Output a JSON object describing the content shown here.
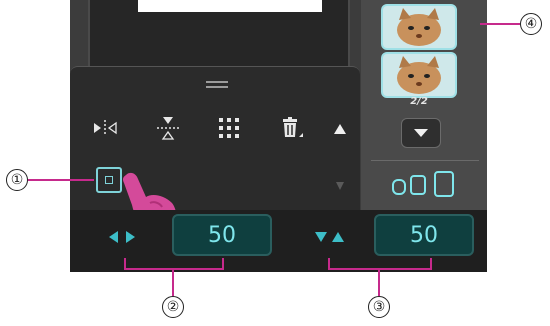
{
  "editor": {
    "page_count": "2/2",
    "horizontal_value": "50",
    "vertical_value": "50"
  },
  "tools": {
    "mirror_horizontal": "mirror-horizontal-icon",
    "mirror_vertical": "mirror-vertical-icon",
    "array": "array-icon",
    "delete": "trash-icon",
    "scroll_up": "triangle-up-icon",
    "scroll_down": "triangle-down-icon"
  },
  "callouts": [
    "①",
    "②",
    "③",
    "④"
  ],
  "colors": {
    "accent": "#7fe6ec",
    "marker": "#c62a8c",
    "value_box": "#0f3f3f"
  }
}
